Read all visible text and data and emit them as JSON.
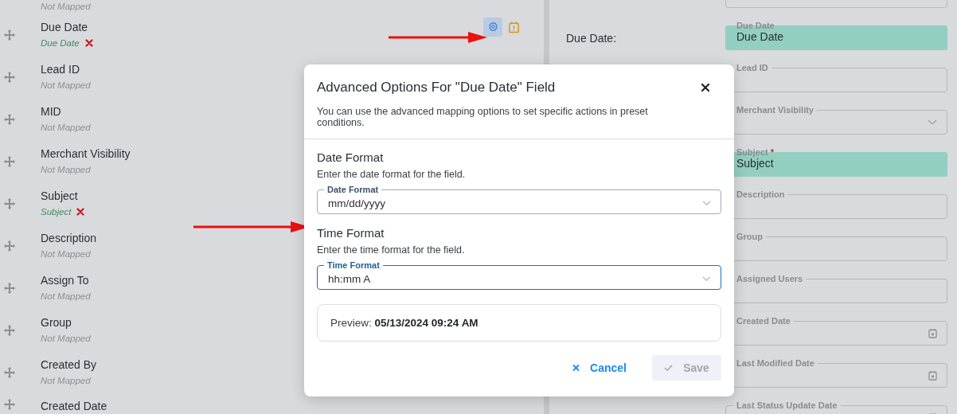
{
  "mapping_list": {
    "items": [
      {
        "mapping": "Not Mapped",
        "mapped": false,
        "show_actions": false
      },
      {
        "label": "Due Date",
        "mapping": "Due Date",
        "mapped": true,
        "show_actions": true
      },
      {
        "label": "Lead ID",
        "mapping": "Not Mapped",
        "mapped": false,
        "show_actions": false
      },
      {
        "label": "MID",
        "mapping": "Not Mapped",
        "mapped": false,
        "show_actions": false
      },
      {
        "label": "Merchant Visibility",
        "mapping": "Not Mapped",
        "mapped": false,
        "show_actions": false
      },
      {
        "label": "Subject",
        "mapping": "Subject",
        "mapped": true,
        "show_actions": false
      },
      {
        "label": "Description",
        "mapping": "Not Mapped",
        "mapped": false,
        "show_actions": false
      },
      {
        "label": "Assign To",
        "mapping": "Not Mapped",
        "mapped": false,
        "show_actions": false
      },
      {
        "label": "Group",
        "mapping": "Not Mapped",
        "mapped": false,
        "show_actions": false
      },
      {
        "label": "Created By",
        "mapping": "Not Mapped",
        "mapped": false,
        "show_actions": false
      },
      {
        "label": "Created Date"
      }
    ]
  },
  "form": {
    "fields": [
      {
        "row_label": "Due Date:",
        "label": "Due Date",
        "value": "Due Date",
        "kind": "filled"
      },
      {
        "label": "Lead ID",
        "kind": "text"
      },
      {
        "label": "Merchant Visibility",
        "kind": "select"
      },
      {
        "label": "Subject",
        "required_mark": "*",
        "value": "Subject",
        "kind": "filled"
      },
      {
        "label": "Description",
        "kind": "text"
      },
      {
        "label": "Group",
        "kind": "text"
      },
      {
        "label": "Assigned Users",
        "kind": "text"
      },
      {
        "label": "Created Date",
        "kind": "date"
      },
      {
        "label": "Last Modified Date",
        "kind": "date"
      },
      {
        "label": "Last Status Update Date",
        "kind": "date"
      }
    ]
  },
  "modal": {
    "title": "Advanced Options For \"Due Date\" Field",
    "description": "You can use the advanced mapping options to set specific actions in preset conditions.",
    "sections": [
      {
        "heading": "Date Format",
        "hint": "Enter the date format for the field.",
        "field_label": "Date Format",
        "value": "mm/dd/yyyy",
        "focused": false
      },
      {
        "heading": "Time Format",
        "hint": "Enter the time format for the field.",
        "field_label": "Time Format",
        "value": "hh:mm A",
        "focused": true
      }
    ],
    "preview": "Preview: **05/13/2024 09:24 AM**",
    "cancel": "Cancel",
    "save": {
      "label": "Save",
      "disabled": true
    }
  }
}
